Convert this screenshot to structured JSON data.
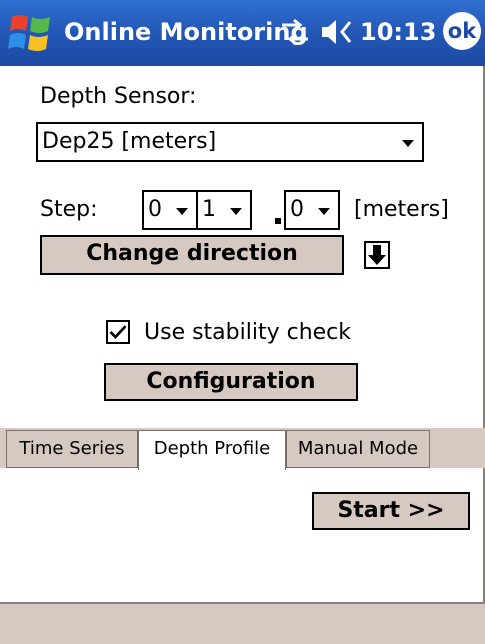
{
  "titlebar": {
    "title": "Online Monitoring",
    "time": "10:13",
    "ok_label": "ok",
    "icons": [
      "windows-start-icon",
      "connection-sync-icon",
      "volume-icon"
    ],
    "color": "#2459b8"
  },
  "depth_sensor": {
    "label": "Depth Sensor:",
    "selected": "Dep25 [meters]"
  },
  "step": {
    "label": "Step:",
    "digit1": "0",
    "digit2": "1",
    "decimal": "0",
    "unit": "[meters]"
  },
  "buttons": {
    "change_direction": "Change direction",
    "configuration": "Configuration",
    "start": "Start >>"
  },
  "direction_icon": "arrow-down-icon",
  "stability": {
    "label": "Use stability check",
    "checked": true
  },
  "tabs": [
    {
      "label": "Time Series",
      "active": false
    },
    {
      "label": "Depth Profile",
      "active": true
    },
    {
      "label": "Manual Mode",
      "active": false
    }
  ],
  "colors": {
    "button_face": "#d6c9c1",
    "background": "#ffffff"
  }
}
